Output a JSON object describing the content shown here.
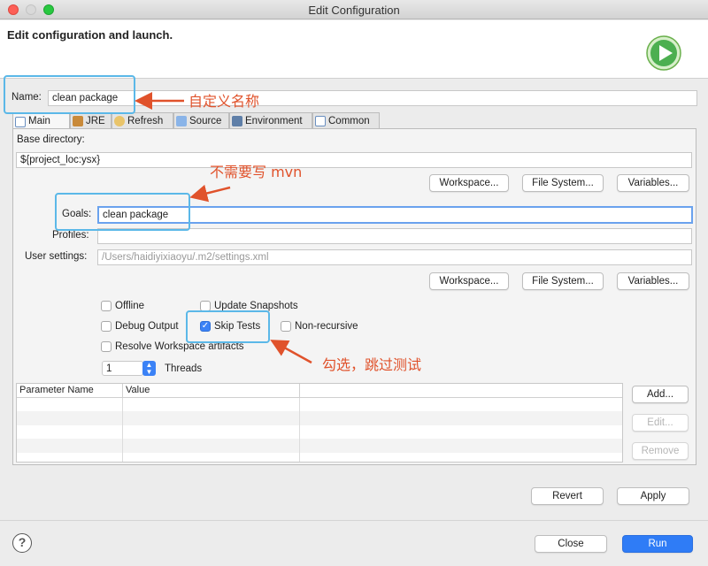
{
  "window": {
    "title": "Edit Configuration"
  },
  "header": {
    "title": "Edit configuration and launch.",
    "icon": "run-icon"
  },
  "name": {
    "label": "Name:",
    "value": "clean package"
  },
  "tabs": [
    {
      "label": "Main",
      "icon": "main-tab-icon"
    },
    {
      "label": "JRE",
      "icon": "jre-icon"
    },
    {
      "label": "Refresh",
      "icon": "refresh-icon"
    },
    {
      "label": "Source",
      "icon": "source-icon"
    },
    {
      "label": "Environment",
      "icon": "environment-icon"
    },
    {
      "label": "Common",
      "icon": "common-icon"
    }
  ],
  "main": {
    "base_dir": {
      "label": "Base directory:",
      "value": "${project_loc:ysx}"
    },
    "buttons1": {
      "workspace": "Workspace...",
      "file_system": "File System...",
      "variables": "Variables..."
    },
    "goals": {
      "label": "Goals:",
      "value": "clean package"
    },
    "profiles": {
      "label": "Profiles:",
      "value": ""
    },
    "user_settings": {
      "label": "User settings:",
      "placeholder": "/Users/haidiyixiaoyu/.m2/settings.xml"
    },
    "buttons2": {
      "workspace": "Workspace...",
      "file_system": "File System...",
      "variables": "Variables..."
    },
    "options": {
      "offline": "Offline",
      "update_snapshots": "Update Snapshots",
      "debug_output": "Debug Output",
      "skip_tests": "Skip Tests",
      "non_recursive": "Non-recursive",
      "resolve_workspace": "Resolve Workspace artifacts"
    },
    "threads": {
      "value": "1",
      "label": "Threads"
    },
    "params": {
      "columns": [
        "Parameter Name",
        "Value"
      ],
      "add": "Add...",
      "edit": "Edit...",
      "remove": "Remove"
    }
  },
  "footer": {
    "revert": "Revert",
    "apply": "Apply",
    "close": "Close",
    "run": "Run",
    "help": "?"
  },
  "annotations": {
    "name_note": "自定义名称",
    "goals_note": "不需要写 mvn",
    "skip_note": "勾选，跳过测试"
  },
  "colors": {
    "accent": "#2f7cf6",
    "highlight": "#5bb8e8",
    "note": "#e0522b"
  }
}
